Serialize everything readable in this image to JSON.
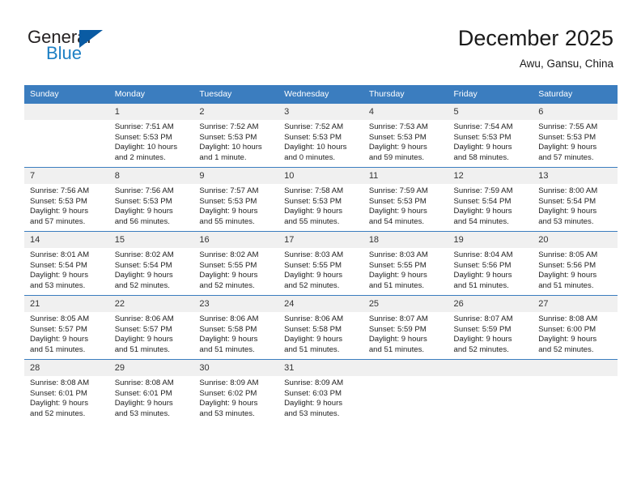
{
  "logo": {
    "word_one": "General",
    "word_two": "Blue",
    "triangle_icon": "triangle-icon"
  },
  "header": {
    "title": "December 2025",
    "subtitle": "Awu, Gansu, China"
  },
  "calendar": {
    "weekday_headers": [
      "Sunday",
      "Monday",
      "Tuesday",
      "Wednesday",
      "Thursday",
      "Friday",
      "Saturday"
    ],
    "colors": {
      "header_blue": "#3b7dbf",
      "daynum_bg": "#f0f0f0",
      "logo_blue": "#1c7fc4",
      "logo_triangle": "#0a5ba3"
    },
    "weeks": [
      [
        {
          "day": "",
          "sunrise": "",
          "sunset": "",
          "daylight_line1": "",
          "daylight_line2": "",
          "blank": true
        },
        {
          "day": "1",
          "sunrise": "Sunrise: 7:51 AM",
          "sunset": "Sunset: 5:53 PM",
          "daylight_line1": "Daylight: 10 hours",
          "daylight_line2": "and 2 minutes.",
          "blank": false
        },
        {
          "day": "2",
          "sunrise": "Sunrise: 7:52 AM",
          "sunset": "Sunset: 5:53 PM",
          "daylight_line1": "Daylight: 10 hours",
          "daylight_line2": "and 1 minute.",
          "blank": false
        },
        {
          "day": "3",
          "sunrise": "Sunrise: 7:52 AM",
          "sunset": "Sunset: 5:53 PM",
          "daylight_line1": "Daylight: 10 hours",
          "daylight_line2": "and 0 minutes.",
          "blank": false
        },
        {
          "day": "4",
          "sunrise": "Sunrise: 7:53 AM",
          "sunset": "Sunset: 5:53 PM",
          "daylight_line1": "Daylight: 9 hours",
          "daylight_line2": "and 59 minutes.",
          "blank": false
        },
        {
          "day": "5",
          "sunrise": "Sunrise: 7:54 AM",
          "sunset": "Sunset: 5:53 PM",
          "daylight_line1": "Daylight: 9 hours",
          "daylight_line2": "and 58 minutes.",
          "blank": false
        },
        {
          "day": "6",
          "sunrise": "Sunrise: 7:55 AM",
          "sunset": "Sunset: 5:53 PM",
          "daylight_line1": "Daylight: 9 hours",
          "daylight_line2": "and 57 minutes.",
          "blank": false
        }
      ],
      [
        {
          "day": "7",
          "sunrise": "Sunrise: 7:56 AM",
          "sunset": "Sunset: 5:53 PM",
          "daylight_line1": "Daylight: 9 hours",
          "daylight_line2": "and 57 minutes.",
          "blank": false
        },
        {
          "day": "8",
          "sunrise": "Sunrise: 7:56 AM",
          "sunset": "Sunset: 5:53 PM",
          "daylight_line1": "Daylight: 9 hours",
          "daylight_line2": "and 56 minutes.",
          "blank": false
        },
        {
          "day": "9",
          "sunrise": "Sunrise: 7:57 AM",
          "sunset": "Sunset: 5:53 PM",
          "daylight_line1": "Daylight: 9 hours",
          "daylight_line2": "and 55 minutes.",
          "blank": false
        },
        {
          "day": "10",
          "sunrise": "Sunrise: 7:58 AM",
          "sunset": "Sunset: 5:53 PM",
          "daylight_line1": "Daylight: 9 hours",
          "daylight_line2": "and 55 minutes.",
          "blank": false
        },
        {
          "day": "11",
          "sunrise": "Sunrise: 7:59 AM",
          "sunset": "Sunset: 5:53 PM",
          "daylight_line1": "Daylight: 9 hours",
          "daylight_line2": "and 54 minutes.",
          "blank": false
        },
        {
          "day": "12",
          "sunrise": "Sunrise: 7:59 AM",
          "sunset": "Sunset: 5:54 PM",
          "daylight_line1": "Daylight: 9 hours",
          "daylight_line2": "and 54 minutes.",
          "blank": false
        },
        {
          "day": "13",
          "sunrise": "Sunrise: 8:00 AM",
          "sunset": "Sunset: 5:54 PM",
          "daylight_line1": "Daylight: 9 hours",
          "daylight_line2": "and 53 minutes.",
          "blank": false
        }
      ],
      [
        {
          "day": "14",
          "sunrise": "Sunrise: 8:01 AM",
          "sunset": "Sunset: 5:54 PM",
          "daylight_line1": "Daylight: 9 hours",
          "daylight_line2": "and 53 minutes.",
          "blank": false
        },
        {
          "day": "15",
          "sunrise": "Sunrise: 8:02 AM",
          "sunset": "Sunset: 5:54 PM",
          "daylight_line1": "Daylight: 9 hours",
          "daylight_line2": "and 52 minutes.",
          "blank": false
        },
        {
          "day": "16",
          "sunrise": "Sunrise: 8:02 AM",
          "sunset": "Sunset: 5:55 PM",
          "daylight_line1": "Daylight: 9 hours",
          "daylight_line2": "and 52 minutes.",
          "blank": false
        },
        {
          "day": "17",
          "sunrise": "Sunrise: 8:03 AM",
          "sunset": "Sunset: 5:55 PM",
          "daylight_line1": "Daylight: 9 hours",
          "daylight_line2": "and 52 minutes.",
          "blank": false
        },
        {
          "day": "18",
          "sunrise": "Sunrise: 8:03 AM",
          "sunset": "Sunset: 5:55 PM",
          "daylight_line1": "Daylight: 9 hours",
          "daylight_line2": "and 51 minutes.",
          "blank": false
        },
        {
          "day": "19",
          "sunrise": "Sunrise: 8:04 AM",
          "sunset": "Sunset: 5:56 PM",
          "daylight_line1": "Daylight: 9 hours",
          "daylight_line2": "and 51 minutes.",
          "blank": false
        },
        {
          "day": "20",
          "sunrise": "Sunrise: 8:05 AM",
          "sunset": "Sunset: 5:56 PM",
          "daylight_line1": "Daylight: 9 hours",
          "daylight_line2": "and 51 minutes.",
          "blank": false
        }
      ],
      [
        {
          "day": "21",
          "sunrise": "Sunrise: 8:05 AM",
          "sunset": "Sunset: 5:57 PM",
          "daylight_line1": "Daylight: 9 hours",
          "daylight_line2": "and 51 minutes.",
          "blank": false
        },
        {
          "day": "22",
          "sunrise": "Sunrise: 8:06 AM",
          "sunset": "Sunset: 5:57 PM",
          "daylight_line1": "Daylight: 9 hours",
          "daylight_line2": "and 51 minutes.",
          "blank": false
        },
        {
          "day": "23",
          "sunrise": "Sunrise: 8:06 AM",
          "sunset": "Sunset: 5:58 PM",
          "daylight_line1": "Daylight: 9 hours",
          "daylight_line2": "and 51 minutes.",
          "blank": false
        },
        {
          "day": "24",
          "sunrise": "Sunrise: 8:06 AM",
          "sunset": "Sunset: 5:58 PM",
          "daylight_line1": "Daylight: 9 hours",
          "daylight_line2": "and 51 minutes.",
          "blank": false
        },
        {
          "day": "25",
          "sunrise": "Sunrise: 8:07 AM",
          "sunset": "Sunset: 5:59 PM",
          "daylight_line1": "Daylight: 9 hours",
          "daylight_line2": "and 51 minutes.",
          "blank": false
        },
        {
          "day": "26",
          "sunrise": "Sunrise: 8:07 AM",
          "sunset": "Sunset: 5:59 PM",
          "daylight_line1": "Daylight: 9 hours",
          "daylight_line2": "and 52 minutes.",
          "blank": false
        },
        {
          "day": "27",
          "sunrise": "Sunrise: 8:08 AM",
          "sunset": "Sunset: 6:00 PM",
          "daylight_line1": "Daylight: 9 hours",
          "daylight_line2": "and 52 minutes.",
          "blank": false
        }
      ],
      [
        {
          "day": "28",
          "sunrise": "Sunrise: 8:08 AM",
          "sunset": "Sunset: 6:01 PM",
          "daylight_line1": "Daylight: 9 hours",
          "daylight_line2": "and 52 minutes.",
          "blank": false
        },
        {
          "day": "29",
          "sunrise": "Sunrise: 8:08 AM",
          "sunset": "Sunset: 6:01 PM",
          "daylight_line1": "Daylight: 9 hours",
          "daylight_line2": "and 53 minutes.",
          "blank": false
        },
        {
          "day": "30",
          "sunrise": "Sunrise: 8:09 AM",
          "sunset": "Sunset: 6:02 PM",
          "daylight_line1": "Daylight: 9 hours",
          "daylight_line2": "and 53 minutes.",
          "blank": false
        },
        {
          "day": "31",
          "sunrise": "Sunrise: 8:09 AM",
          "sunset": "Sunset: 6:03 PM",
          "daylight_line1": "Daylight: 9 hours",
          "daylight_line2": "and 53 minutes.",
          "blank": false
        },
        {
          "day": "",
          "sunrise": "",
          "sunset": "",
          "daylight_line1": "",
          "daylight_line2": "",
          "blank": true
        },
        {
          "day": "",
          "sunrise": "",
          "sunset": "",
          "daylight_line1": "",
          "daylight_line2": "",
          "blank": true
        },
        {
          "day": "",
          "sunrise": "",
          "sunset": "",
          "daylight_line1": "",
          "daylight_line2": "",
          "blank": true
        }
      ]
    ]
  }
}
